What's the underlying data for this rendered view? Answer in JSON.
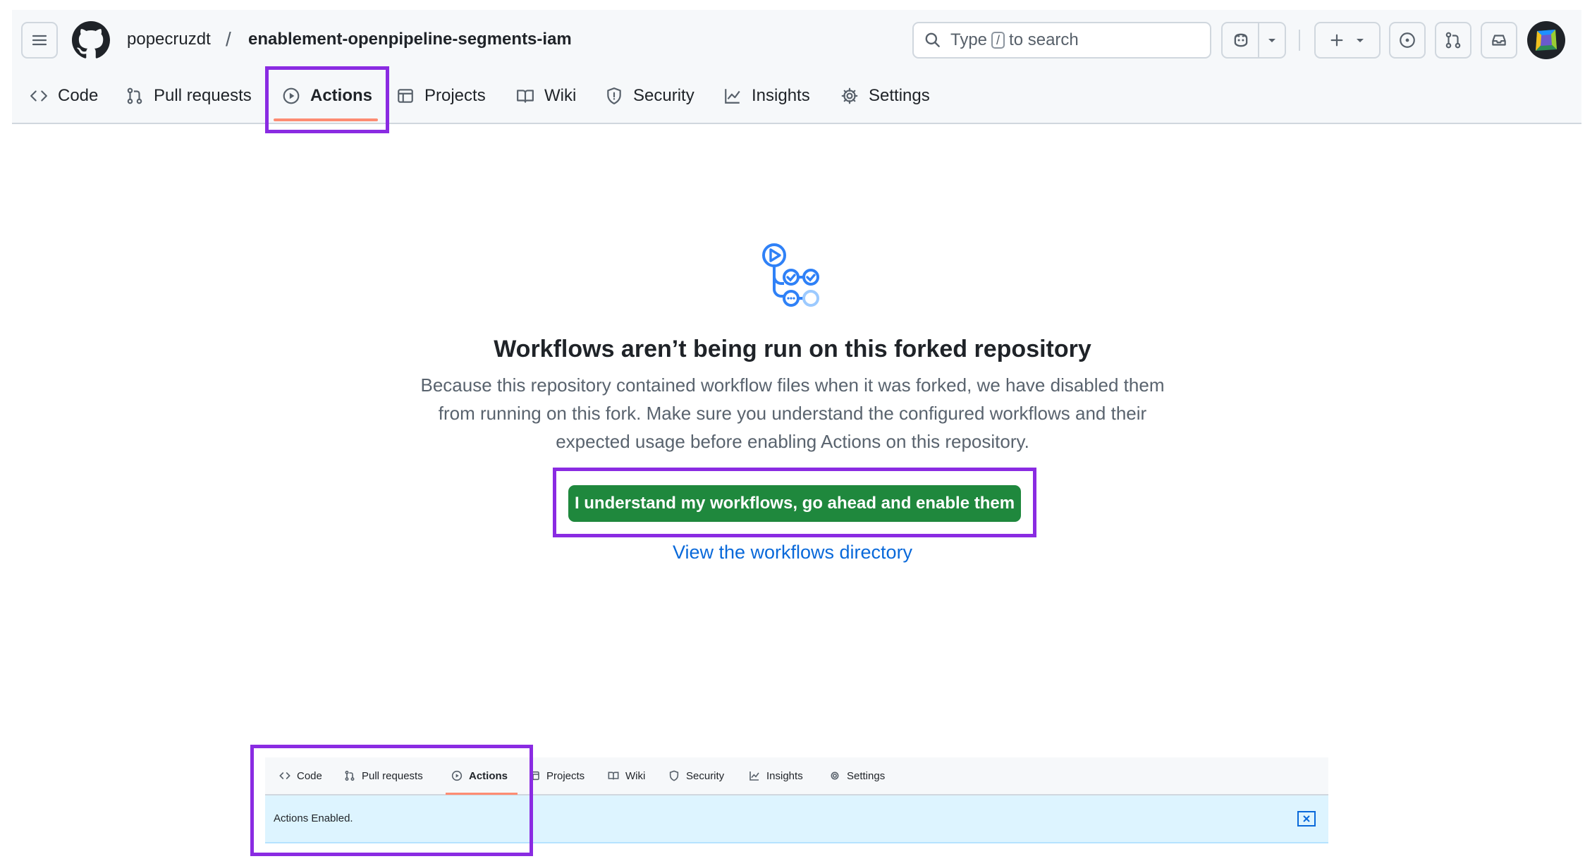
{
  "header": {
    "owner": "popecruzdt",
    "separator": "/",
    "repo": "enablement-openpipeline-segments-iam",
    "search": {
      "prefix": "Type",
      "key": "/",
      "suffix": "to search"
    }
  },
  "tabs": [
    {
      "label": "Code",
      "icon": "code-icon"
    },
    {
      "label": "Pull requests",
      "icon": "pull-request-icon"
    },
    {
      "label": "Actions",
      "icon": "play-icon",
      "selected": true
    },
    {
      "label": "Projects",
      "icon": "table-icon"
    },
    {
      "label": "Wiki",
      "icon": "book-icon"
    },
    {
      "label": "Security",
      "icon": "shield-icon"
    },
    {
      "label": "Insights",
      "icon": "graph-icon"
    },
    {
      "label": "Settings",
      "icon": "gear-icon"
    }
  ],
  "main": {
    "title": "Workflows aren’t being run on this forked repository",
    "description_lines": [
      "Because this repository contained workflow files when it was forked, we have disabled them",
      "from running on this fork. Make sure you understand the configured workflows and their",
      "expected usage before enabling Actions on this repository."
    ],
    "enable_button": "I understand my workflows, go ahead and enable them",
    "workflows_link": "View the workflows directory"
  },
  "result_panel": {
    "tabs": [
      "Code",
      "Pull requests",
      "Actions",
      "Projects",
      "Wiki",
      "Security",
      "Insights",
      "Settings"
    ],
    "flash_message": "Actions Enabled."
  },
  "colors": {
    "accent_green": "#1f883d",
    "link_blue": "#0969da",
    "highlight_purple": "#8a2be2",
    "tab_underline": "#fd8c73",
    "flash_bg": "#ddf4ff"
  }
}
